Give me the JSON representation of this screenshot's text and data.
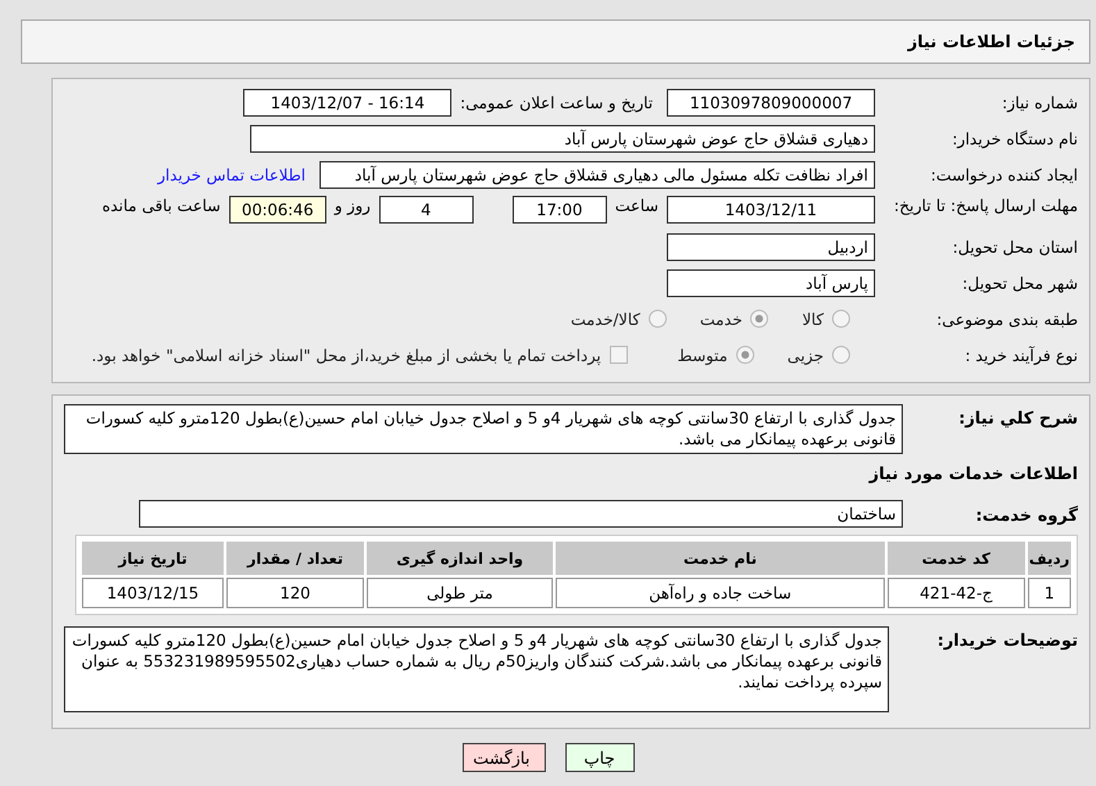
{
  "header": {
    "title": "جزئیات اطلاعات نیاز"
  },
  "need_number": {
    "label": "شماره نیاز:",
    "value": "1103097809000007"
  },
  "announce": {
    "label": "تاریخ و ساعت اعلان عمومی:",
    "value": "1403/12/07 - 16:14"
  },
  "buyer_org": {
    "label": "نام دستگاه خریدار:",
    "value": "دهیاری قشلاق حاج عوض شهرستان پارس آباد"
  },
  "requester": {
    "label": "ایجاد کننده درخواست:",
    "value": "افراد نظافت تکله مسئول مالی دهیاری قشلاق حاج عوض شهرستان پارس آباد",
    "link": "اطلاعات تماس خریدار"
  },
  "deadline": {
    "label": "مهلت ارسال پاسخ: تا تاریخ:",
    "date": "1403/12/11",
    "time_label": "ساعت",
    "time": "17:00",
    "days": "4",
    "days_label": "روز و",
    "remaining": "00:06:46",
    "remaining_label": "ساعت باقی مانده"
  },
  "province": {
    "label": "استان محل تحویل:",
    "value": "اردبیل"
  },
  "city": {
    "label": "شهر محل تحویل:",
    "value": "پارس آباد"
  },
  "category": {
    "label": "طبقه بندی موضوعی:",
    "options": [
      {
        "label": "کالا",
        "selected": false
      },
      {
        "label": "خدمت",
        "selected": true
      },
      {
        "label": "کالا/خدمت",
        "selected": false
      }
    ]
  },
  "purchase_type": {
    "label": "نوع فرآیند خرید :",
    "options": [
      {
        "label": "جزیی",
        "selected": false
      },
      {
        "label": "متوسط",
        "selected": true
      }
    ],
    "payment_checkbox": {
      "checked": false,
      "label": "پرداخت تمام یا بخشی از مبلغ خرید،از محل \"اسناد خزانه اسلامی\" خواهد بود."
    }
  },
  "description": {
    "label": "شرح کلي نیاز:",
    "value": "جدول گذاری با ارتفاع 30سانتی کوچه های شهریار 4و 5 و اصلاح جدول خیابان امام حسین(ع)بطول 120مترو کلیه کسورات قانونی برعهده پیمانکار می باشد."
  },
  "services_title": "اطلاعات خدمات مورد نیاز",
  "service_group": {
    "label": "گروه خدمت:",
    "value": "ساختمان"
  },
  "table": {
    "columns": [
      "ردیف",
      "کد خدمت",
      "نام خدمت",
      "واحد اندازه گیری",
      "تعداد / مقدار",
      "تاریخ نیاز"
    ],
    "rows": [
      [
        "1",
        "ج-42-421",
        "ساخت جاده و راه‌آهن",
        "متر طولی",
        "120",
        "1403/12/15"
      ]
    ]
  },
  "buyer_notes": {
    "label": "توضیحات خریدار:",
    "value": "جدول گذاری با ارتفاع 30سانتی کوچه های شهریار 4و 5 و اصلاح جدول خیابان امام حسین(ع)بطول 120مترو کلیه کسورات قانونی برعهده پیمانکار می باشد.شرکت کنندگان واریز50م ریال به شماره حساب دهیاری553231989595502 به عنوان سپرده پرداخت نمایند."
  },
  "buttons": [
    {
      "kind": "print",
      "label": "چاپ"
    },
    {
      "kind": "back",
      "label": "بازگشت"
    }
  ]
}
